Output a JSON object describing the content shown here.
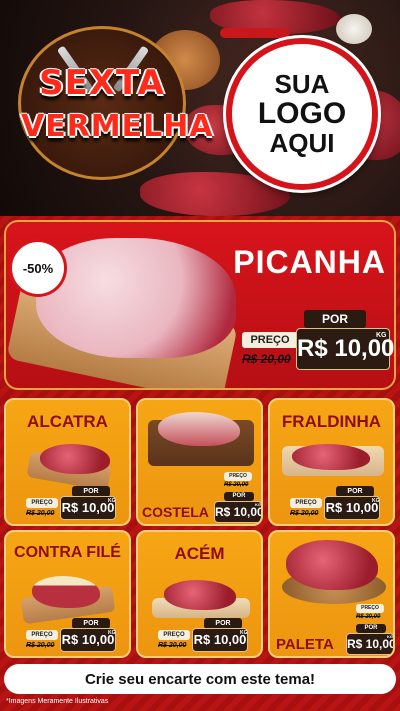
{
  "hero": {
    "badge": {
      "line1": "SEXTA",
      "line2": "VERMELHA"
    },
    "logo_placeholder": {
      "line1": "SUA",
      "line2": "LOGO",
      "line3": "AQUI"
    }
  },
  "featured": {
    "discount": "-50%",
    "name": "PICANHA",
    "price_label": "PREÇO",
    "old_price": "R$ 20,00",
    "por_label": "POR",
    "new_price": "R$ 10,00",
    "unit": "KG"
  },
  "products": [
    {
      "name": "ALCATRA",
      "price_label": "PREÇO",
      "old_price": "R$ 20,00",
      "por_label": "POR",
      "new_price": "R$ 10,00",
      "unit": "KG"
    },
    {
      "name": "COSTELA",
      "price_label": "PREÇO",
      "old_price": "R$ 20,00",
      "por_label": "POR",
      "new_price": "R$ 10,00",
      "unit": "KG"
    },
    {
      "name": "FRALDINHA",
      "price_label": "PREÇO",
      "old_price": "R$ 20,00",
      "por_label": "POR",
      "new_price": "R$ 10,00",
      "unit": "KG"
    },
    {
      "name": "CONTRA FILÉ",
      "price_label": "PREÇO",
      "old_price": "R$ 20,00",
      "por_label": "POR",
      "new_price": "R$ 10,00",
      "unit": "KG"
    },
    {
      "name": "ACÉM",
      "price_label": "PREÇO",
      "old_price": "R$ 20,00",
      "por_label": "POR",
      "new_price": "R$ 10,00",
      "unit": "KG"
    },
    {
      "name": "PALETA",
      "price_label": "PREÇO",
      "old_price": "R$ 20,00",
      "por_label": "POR",
      "new_price": "R$ 10,00",
      "unit": "KG"
    }
  ],
  "cta": "Crie seu encarte com este tema!",
  "disclaimer": "*Imagens Meramente Ilustrativas",
  "colors": {
    "primary_red": "#d8141b",
    "card_orange": "#f6a614",
    "title_red": "#8e0d0d",
    "tag_dark": "#2b1b12"
  }
}
